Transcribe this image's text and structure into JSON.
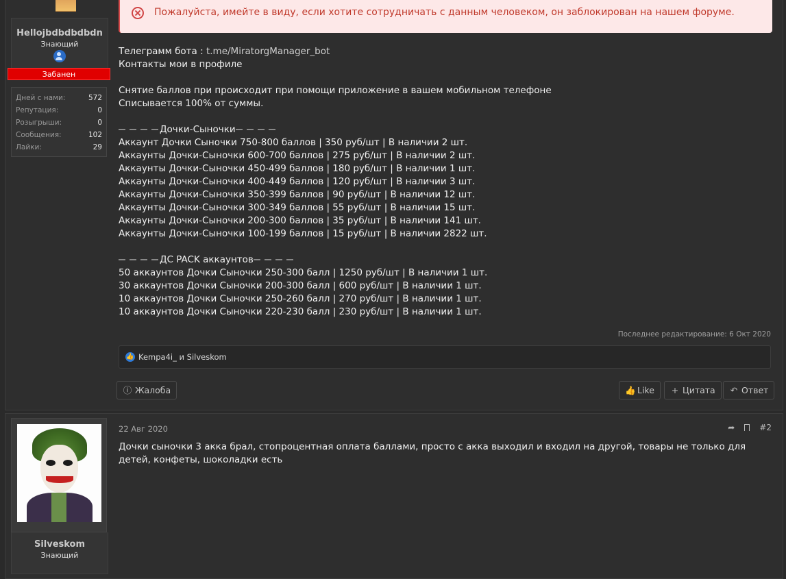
{
  "notice": {
    "text": "Пожалуйста, имейте в виду, если хотите сотрудничать с данным человеком, он заблокирован на нашем форуме."
  },
  "post1": {
    "user": {
      "name": "Hellojbdbdbdbdn",
      "title": "Знающий",
      "banned_label": "Забанен",
      "stats": [
        {
          "label": "Дней с нами:",
          "value": "572"
        },
        {
          "label": "Репутация:",
          "value": "0"
        },
        {
          "label": "Розыгрыши:",
          "value": "0"
        },
        {
          "label": "Сообщения:",
          "value": "102"
        },
        {
          "label": "Лайки:",
          "value": "29"
        }
      ]
    },
    "body": {
      "bot_label": "Телеграмм бота :",
      "bot_link": "t.me/MiratorgManager_bot",
      "line2": "Контакты мои в профиле",
      "line3": "Снятие баллов при происходит при помощи приложение в вашем мобильном телефоне",
      "line4": "Списывается 100% от суммы.",
      "section1_title": "Дочки-Сыночки",
      "section1_items": [
        "Аккаунт Дочки Сыночки 750-800 баллов | 350 руб/шт | В наличии 2 шт.",
        "Аккаунты Дочки-Сыночки 600-700 баллов | 275 руб/шт | В наличии 2 шт.",
        "Аккаунты Дочки-Сыночки 450-499 баллов | 180 руб/шт | В наличии 1 шт.",
        "Аккаунты Дочки-Сыночки 400-449 баллов | 120 руб/шт | В наличии 3 шт.",
        "Аккаунты Дочки-Сыночки 350-399 баллов | 90 руб/шт | В наличии 12 шт.",
        "Аккаунты Дочки-Сыночки 300-349 баллов | 55 руб/шт | В наличии 15 шт.",
        "Аккаунты Дочки-Сыночки 200-300 баллов | 35 руб/шт | В наличии 141 шт.",
        "Аккаунты Дочки-Сыночки 100-199 баллов | 15 руб/шт | В наличии 2822 шт."
      ],
      "section2_title": "ДС PACK аккаунтов",
      "section2_items": [
        "50 аккаунтов Дочки Сыночки 250-300 балл | 1250 руб/шт | В наличии 1 шт.",
        "30 аккаунтов Дочки Сыночки 200-300 балл | 600 руб/шт | В наличии 1 шт.",
        "10 аккаунтов Дочки Сыночки 250-260 балл | 270 руб/шт | В наличии 1 шт.",
        "10 аккаунтов Дочки Сыночки 220-230 балл | 230 руб/шт | В наличии 1 шт."
      ]
    },
    "edited": "Последнее редактирование: 6 Окт 2020",
    "reactions": "Kempa4i_ и Silveskom",
    "actions": {
      "report": "Жалоба",
      "like": "Like",
      "quote": "Цитата",
      "reply": "Ответ"
    }
  },
  "post2": {
    "user": {
      "name": "Silveskom",
      "title": "Знающий"
    },
    "date": "22 Авг 2020",
    "number": "#2",
    "text": "Дочки сыночки 3 акка брал, стопроцентная оплата баллами, просто с акка выходил и входил на другой, товары не только для детей, конфеты, шоколадки есть"
  }
}
